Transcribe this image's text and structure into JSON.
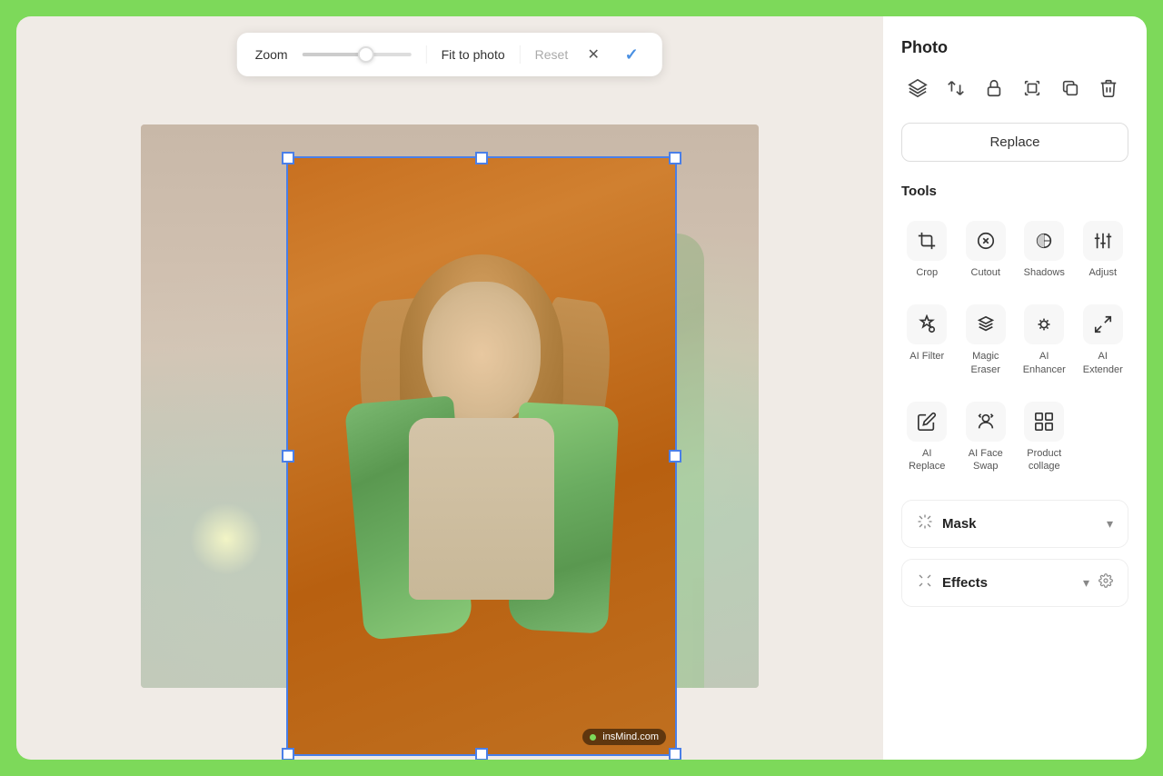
{
  "panel": {
    "title": "Photo",
    "replace_label": "Replace",
    "tools_title": "Tools",
    "mask_title": "Mask",
    "effects_title": "Effects"
  },
  "toolbar_icons": [
    {
      "name": "layers-icon",
      "symbol": "⊞",
      "title": "Layers"
    },
    {
      "name": "flip-icon",
      "symbol": "⇔",
      "title": "Flip"
    },
    {
      "name": "lock-icon",
      "symbol": "🔒",
      "title": "Lock"
    },
    {
      "name": "crop-icon",
      "symbol": "⌗",
      "title": "Crop"
    },
    {
      "name": "duplicate-icon",
      "symbol": "⧉",
      "title": "Duplicate"
    },
    {
      "name": "delete-icon",
      "symbol": "🗑",
      "title": "Delete"
    }
  ],
  "tools": [
    {
      "name": "crop-tool",
      "label": "Crop",
      "icon": "crop"
    },
    {
      "name": "cutout-tool",
      "label": "Cutout",
      "icon": "cutout"
    },
    {
      "name": "shadows-tool",
      "label": "Shadows",
      "icon": "shadows"
    },
    {
      "name": "adjust-tool",
      "label": "Adjust",
      "icon": "adjust"
    },
    {
      "name": "ai-filter-tool",
      "label": "AI Filter",
      "icon": "ai-filter"
    },
    {
      "name": "magic-eraser-tool",
      "label": "Magic Eraser",
      "icon": "magic-eraser"
    },
    {
      "name": "ai-enhancer-tool",
      "label": "AI Enhancer",
      "icon": "ai-enhancer"
    },
    {
      "name": "ai-extender-tool",
      "label": "AI Extender",
      "icon": "ai-extender"
    },
    {
      "name": "ai-replace-tool",
      "label": "AI Replace",
      "icon": "ai-replace"
    },
    {
      "name": "ai-face-swap-tool",
      "label": "AI Face Swap",
      "icon": "ai-face-swap"
    },
    {
      "name": "product-collage-tool",
      "label": "Product collage",
      "icon": "product-collage"
    }
  ],
  "zoom": {
    "label": "Zoom",
    "fit_to_photo": "Fit to photo",
    "reset": "Reset",
    "value": 60
  },
  "watermark": {
    "text": "insMind.com"
  }
}
